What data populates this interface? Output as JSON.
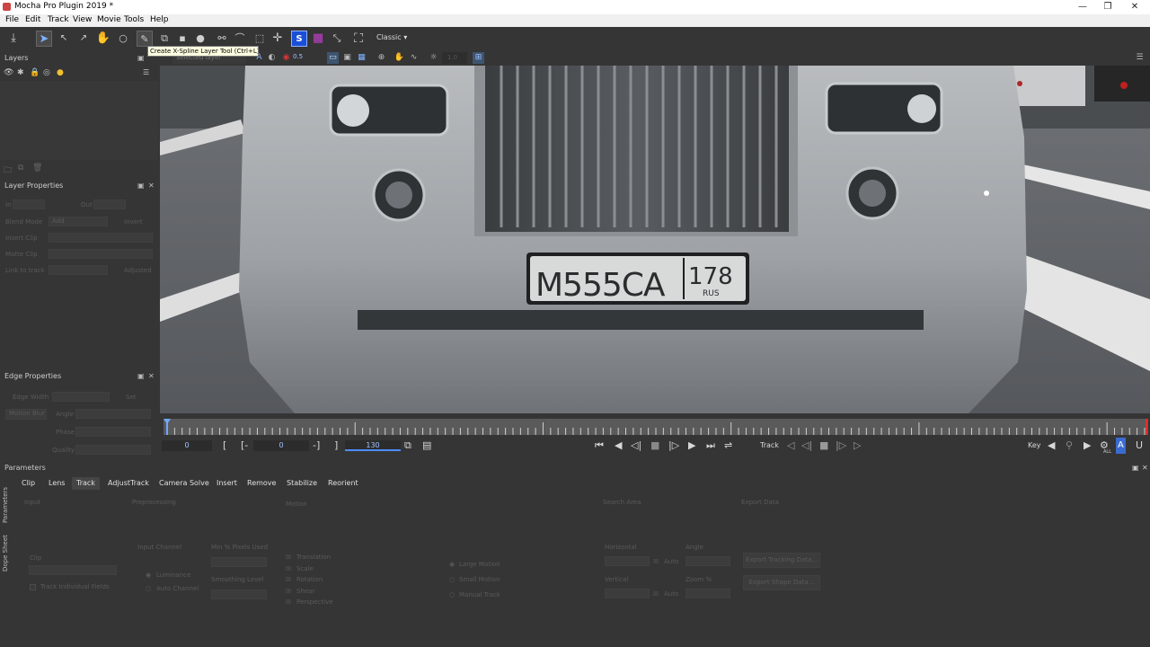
{
  "window": {
    "title": "Mocha Pro Plugin 2019 *",
    "minimize": "—",
    "restore": "❐",
    "close": "✕"
  },
  "menu": [
    "File",
    "Edit",
    "Track",
    "View",
    "Movie",
    "Tools",
    "Help"
  ],
  "toolbar": {
    "workspace": "Classic",
    "tooltip": "Create X-Spline Layer Tool (Ctrl+L)",
    "s_label": "S"
  },
  "view_toolbar": {
    "layer_filter": "Selected layer",
    "zoom_value": "0.5",
    "opacity_value": "1.0"
  },
  "layers_panel": {
    "title": "Layers"
  },
  "layer_properties": {
    "title": "Layer Properties",
    "in_label": "In",
    "out_label": "Out",
    "blend_mode_label": "Blend Mode",
    "blend_mode_value": "Add",
    "invert_label": "Invert",
    "insert_clip_label": "Insert Clip",
    "matte_clip_label": "Matte Clip",
    "link_to_track_label": "Link to track",
    "adjusted_label": "Adjusted"
  },
  "edge_properties": {
    "title": "Edge Properties",
    "edge_width_label": "Edge Width",
    "set_label": "Set",
    "motion_blur_label": "Motion Blur",
    "angle_label": "Angle",
    "phase_label": "Phase",
    "quality_label": "Quality"
  },
  "timeline": {
    "current_frame": "0",
    "in_point": "0",
    "out_point": "130",
    "track_label": "Track",
    "key_label": "Key",
    "all_label": "ALL"
  },
  "footage": {
    "plate_left": "M555CA",
    "plate_region": "178",
    "plate_country": "RUS"
  },
  "parameters": {
    "title": "Parameters",
    "tabs": [
      "Clip",
      "Lens",
      "Track",
      "AdjustTrack",
      "Camera Solve",
      "Insert",
      "Remove",
      "Stabilize",
      "Reorient"
    ],
    "active_tab": "Track",
    "side_tabs": [
      "Parameters",
      "Dope Sheet"
    ],
    "sections": {
      "input": "Input",
      "preprocessing": "Preprocessing",
      "motion": "Motion",
      "search_area": "Search Area",
      "export_data": "Export Data"
    },
    "clip_label": "Clip",
    "track_individual_fields": "Track Individual Fields",
    "input_channel": "Input Channel",
    "luminance": "Luminance",
    "auto_channel": "Auto Channel",
    "min_pixels_used": "Min % Pixels Used",
    "smoothing_level": "Smoothing Level",
    "motion_items": [
      "Translation",
      "Scale",
      "Rotation",
      "Shear",
      "Perspective"
    ],
    "large_motion": "Large Motion",
    "small_motion": "Small Motion",
    "manual_track": "Manual Track",
    "horizontal": "Horizontal",
    "vertical": "Vertical",
    "auto_label": "Auto",
    "angle_label": "Angle",
    "zoom_label": "Zoom %",
    "export_tracking_data": "Export Tracking Data...",
    "export_shape_data": "Export Shape Data..."
  },
  "colors": {
    "accent": "#3d7eff",
    "panel": "#353535",
    "viewer_bg": "#6a6d70",
    "active_s": "#1b4fd8",
    "grid_icon": "#c63fd0"
  }
}
